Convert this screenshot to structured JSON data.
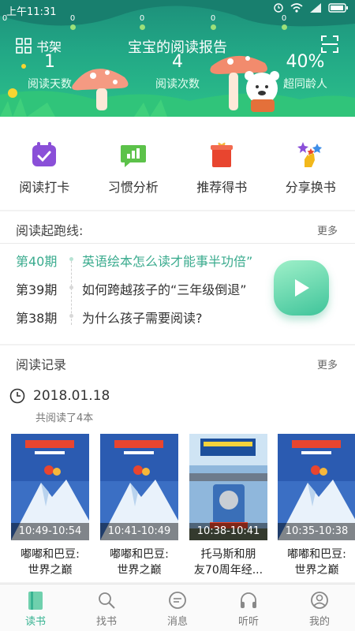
{
  "status": {
    "time": "上午11:31"
  },
  "header": {
    "dots": [
      "0",
      "0",
      "0",
      "0",
      "0"
    ],
    "shelf_label": "书架",
    "title": "宝宝的阅读报告",
    "stats": [
      {
        "num": "1",
        "label": "阅读天数"
      },
      {
        "num": "4",
        "label": "阅读次数"
      },
      {
        "num": "40%",
        "label": "超同龄人"
      }
    ]
  },
  "actions": [
    {
      "label": "阅读打卡",
      "icon": "calendar-check-icon",
      "color": "#8a4fd8"
    },
    {
      "label": "习惯分析",
      "icon": "chart-bubble-icon",
      "color": "#5cc24a"
    },
    {
      "label": "推荐得书",
      "icon": "gift-book-icon",
      "color": "#e8452f"
    },
    {
      "label": "分享换书",
      "icon": "sparkle-hand-icon",
      "color": "#f2b81b"
    }
  ],
  "startline": {
    "title": "阅读起跑线:",
    "more": "更多",
    "episodes": [
      {
        "no": "第40期",
        "title": "英语绘本怎么读才能事半功倍”"
      },
      {
        "no": "第39期",
        "title": "如何跨越孩子的“三年级倒退”"
      },
      {
        "no": "第38期",
        "title": "为什么孩子需要阅读?"
      }
    ]
  },
  "record": {
    "title": "阅读记录",
    "more": "更多",
    "date": "2018.01.18",
    "count": "共阅读了4本",
    "books": [
      {
        "time": "10:49-10:54",
        "title1": "嘟嘟和巴豆:",
        "title2": "世界之巅",
        "cover": "mountain"
      },
      {
        "time": "10:41-10:49",
        "title1": "嘟嘟和巴豆:",
        "title2": "世界之巅",
        "cover": "mountain"
      },
      {
        "time": "10:38-10:41",
        "title1": "托马斯和朋",
        "title2": "友70周年经...",
        "cover": "train"
      },
      {
        "time": "10:35-10:38",
        "title1": "嘟嘟和巴豆:",
        "title2": "世界之巅",
        "cover": "mountain"
      }
    ]
  },
  "nav": [
    {
      "label": "读书",
      "icon": "book-icon",
      "active": true
    },
    {
      "label": "找书",
      "icon": "search-icon",
      "active": false
    },
    {
      "label": "消息",
      "icon": "message-icon",
      "active": false
    },
    {
      "label": "听听",
      "icon": "headphones-icon",
      "active": false
    },
    {
      "label": "我的",
      "icon": "profile-icon",
      "active": false
    }
  ],
  "colors": {
    "accent": "#3aab8e",
    "header": "#22a886"
  }
}
